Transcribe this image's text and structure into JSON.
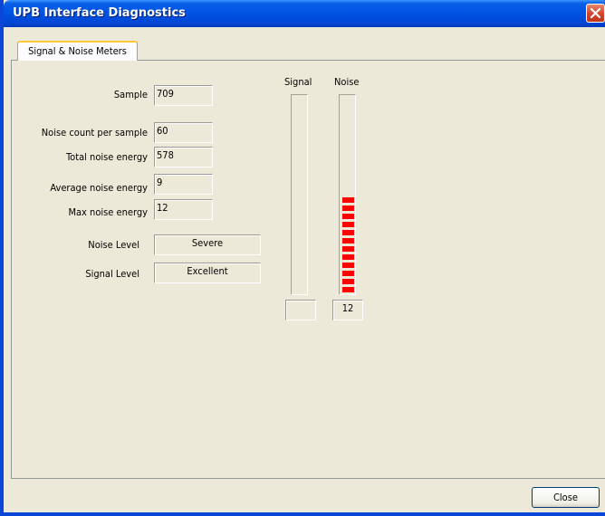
{
  "window": {
    "title": "UPB Interface Diagnostics"
  },
  "tab": {
    "label": "Signal & Noise Meters"
  },
  "fields": {
    "sample": {
      "label": "Sample",
      "value": "709"
    },
    "noise_count": {
      "label": "Noise count per sample",
      "value": "60"
    },
    "total_noise": {
      "label": "Total noise energy",
      "value": "578"
    },
    "avg_noise": {
      "label": "Average noise energy",
      "value": "9"
    },
    "max_noise": {
      "label": "Max noise energy",
      "value": "12"
    },
    "noise_level": {
      "label": "Noise Level",
      "value": "Severe"
    },
    "signal_level": {
      "label": "Signal Level",
      "value": "Excellent"
    }
  },
  "meters": {
    "signal": {
      "label": "Signal",
      "value": "",
      "lit_segments": 0
    },
    "noise": {
      "label": "Noise",
      "value": "12",
      "lit_segments": 12,
      "color": "#ff0000"
    }
  },
  "buttons": {
    "close_label": "Close"
  },
  "colors": {
    "titlebar": "#0055e5",
    "background": "#ece9d8",
    "meter_fill": "#ff0000"
  }
}
